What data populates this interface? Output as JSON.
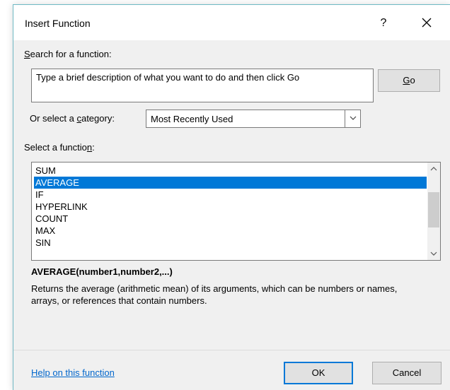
{
  "dialog": {
    "title": "Insert Function",
    "help_glyph": "?",
    "close_icon": "close-icon"
  },
  "search": {
    "label_prefix": "",
    "label_accel": "S",
    "label_rest": "earch for a function:",
    "value": "Type a brief description of what you want to do and then click Go",
    "go_accel": "G",
    "go_rest": "o"
  },
  "category": {
    "label_pre": "Or select a ",
    "label_accel": "c",
    "label_rest": "ategory:",
    "selected": "Most Recently Used"
  },
  "function_list": {
    "label_pre": "Select a functio",
    "label_accel": "n",
    "label_rest": ":",
    "items": [
      "SUM",
      "AVERAGE",
      "IF",
      "HYPERLINK",
      "COUNT",
      "MAX",
      "SIN"
    ],
    "selected_index": 1
  },
  "details": {
    "syntax": "AVERAGE(number1,number2,...)",
    "description": "Returns the average (arithmetic mean) of its arguments, which can be numbers or names, arrays, or references that contain numbers."
  },
  "footer": {
    "help_link": "Help on this function",
    "ok_label": "OK",
    "cancel_label": "Cancel"
  },
  "colors": {
    "selection": "#0078d7",
    "link": "#0066cc",
    "window_border": "#6fb9c4"
  }
}
